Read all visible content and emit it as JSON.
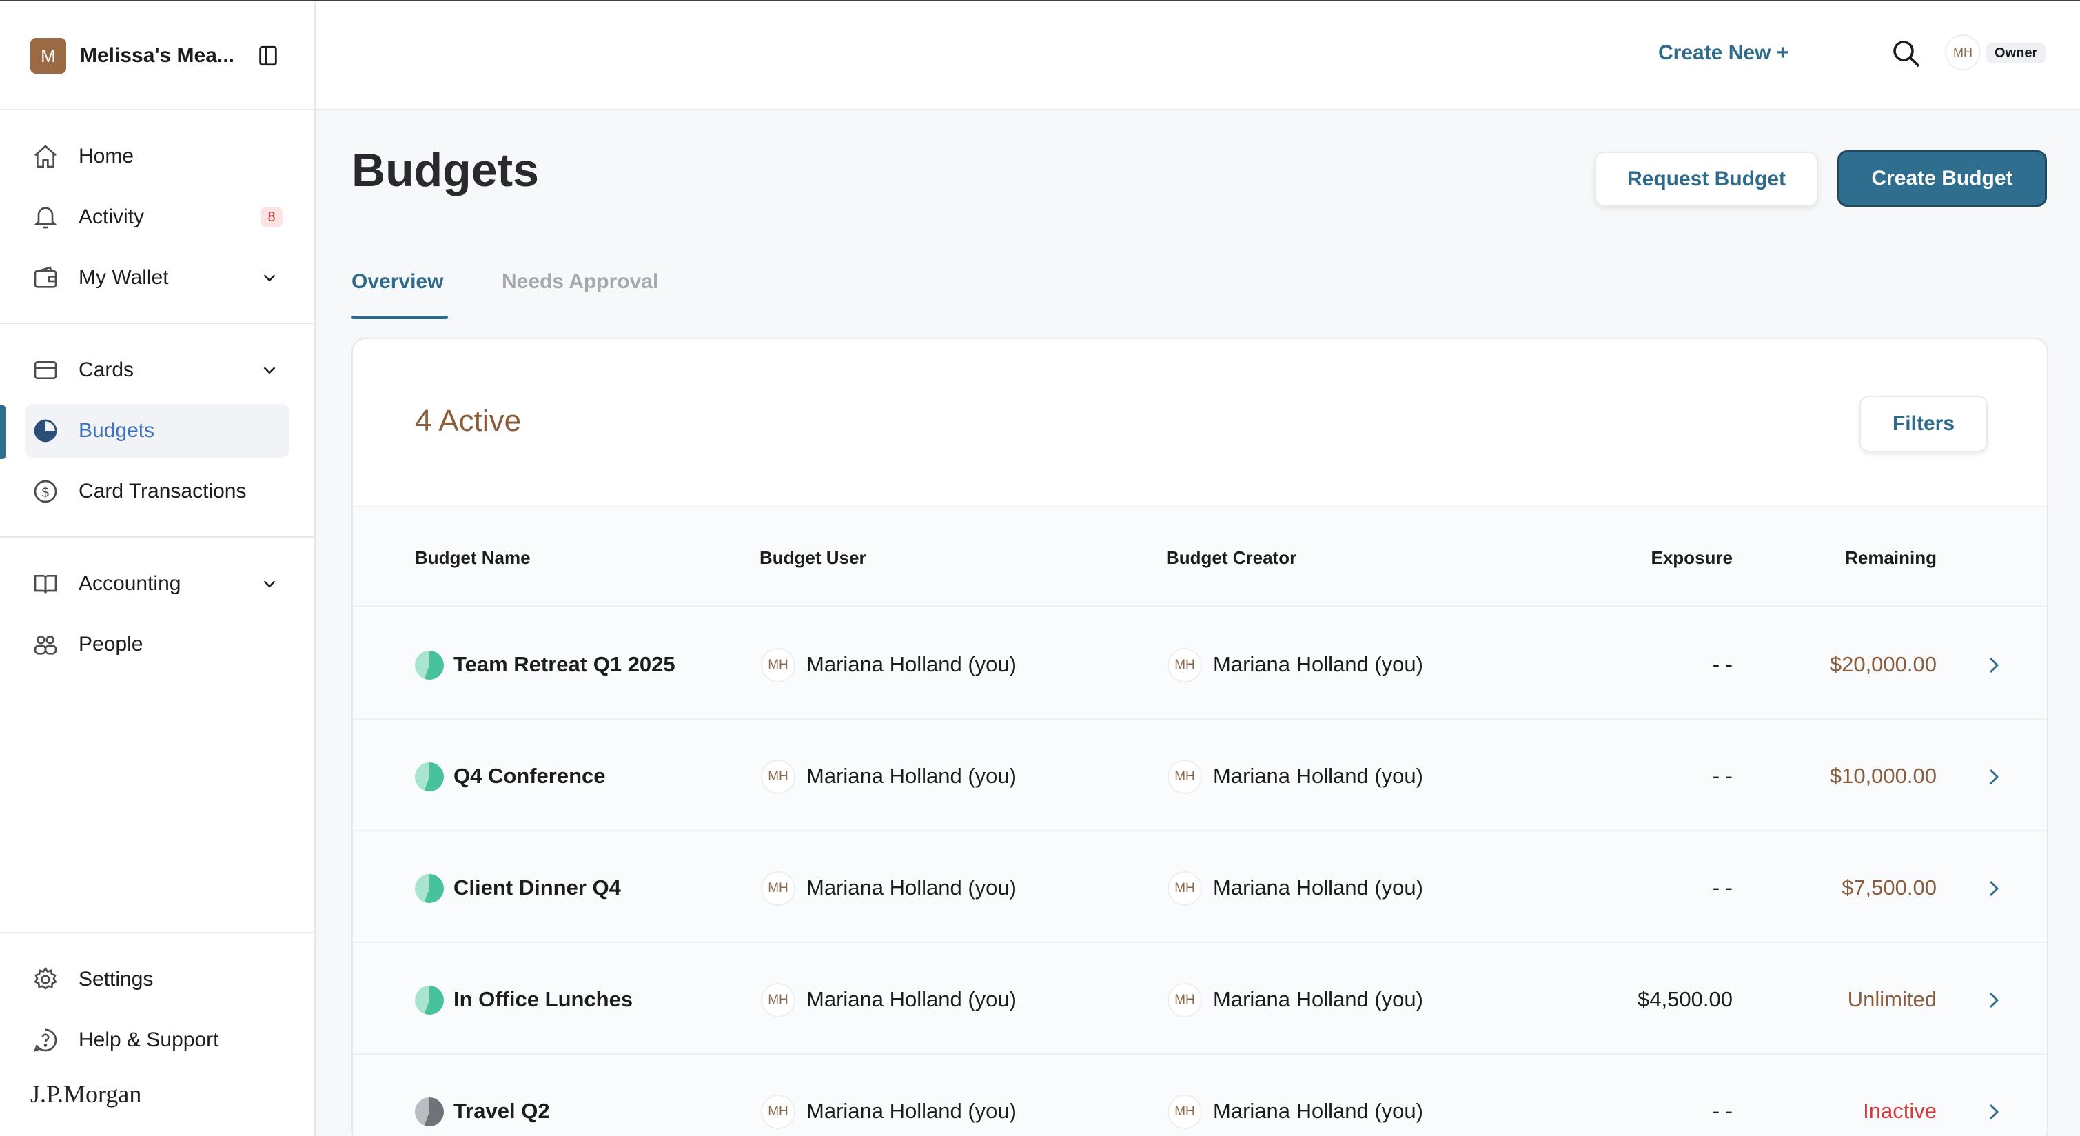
{
  "org": {
    "initial": "M",
    "name": "Melissa's Mea..."
  },
  "nav": {
    "main": [
      {
        "label": "Home",
        "icon": "home-icon"
      },
      {
        "label": "Activity",
        "icon": "bell-icon",
        "badge": "8"
      },
      {
        "label": "My Wallet",
        "icon": "wallet-icon"
      }
    ],
    "spend": [
      {
        "label": "Cards",
        "icon": "card-icon"
      },
      {
        "label": "Budgets",
        "icon": "pie-icon",
        "active": true
      },
      {
        "label": "Card Transactions",
        "icon": "dollar-icon"
      }
    ],
    "manage": [
      {
        "label": "Accounting",
        "icon": "book-icon"
      },
      {
        "label": "People",
        "icon": "people-icon"
      }
    ],
    "footer": [
      {
        "label": "Settings",
        "icon": "gear-icon"
      },
      {
        "label": "Help & Support",
        "icon": "help-icon"
      }
    ],
    "brand": "J.P.Morgan"
  },
  "header": {
    "create_new": "Create New +",
    "avatar": "MH",
    "role": "Owner"
  },
  "page": {
    "title": "Budgets",
    "request_button": "Request Budget",
    "create_button": "Create Budget",
    "tabs": [
      "Overview",
      "Needs Approval"
    ]
  },
  "table": {
    "count_label": "4 Active",
    "filters_label": "Filters",
    "columns": [
      "Budget Name",
      "Budget User",
      "Budget Creator",
      "Exposure",
      "Remaining"
    ],
    "rows": [
      {
        "name": "Team Retreat Q1 2025",
        "status": "active",
        "user_initials": "MH",
        "user": "Mariana Holland (you)",
        "creator_initials": "MH",
        "creator": "Mariana Holland (you)",
        "exposure": "- -",
        "remaining": "$20,000.00",
        "remaining_color": "#8a5e3c"
      },
      {
        "name": "Q4 Conference",
        "status": "active",
        "user_initials": "MH",
        "user": "Mariana Holland (you)",
        "creator_initials": "MH",
        "creator": "Mariana Holland (you)",
        "exposure": "- -",
        "remaining": "$10,000.00",
        "remaining_color": "#8a5e3c"
      },
      {
        "name": "Client Dinner Q4",
        "status": "active",
        "user_initials": "MH",
        "user": "Mariana Holland (you)",
        "creator_initials": "MH",
        "creator": "Mariana Holland (you)",
        "exposure": "- -",
        "remaining": "$7,500.00",
        "remaining_color": "#8a5e3c"
      },
      {
        "name": "In Office Lunches",
        "status": "active",
        "user_initials": "MH",
        "user": "Mariana Holland (you)",
        "creator_initials": "MH",
        "creator": "Mariana Holland (you)",
        "exposure": "$4,500.00",
        "remaining": "Unlimited",
        "remaining_color": "#8a5e3c"
      },
      {
        "name": "Travel Q2",
        "status": "inactive",
        "user_initials": "MH",
        "user": "Mariana Holland (you)",
        "creator_initials": "MH",
        "creator": "Mariana Holland (you)",
        "exposure": "- -",
        "remaining": "Inactive",
        "remaining_color": "#d23b3b"
      }
    ]
  },
  "colors": {
    "accent": "#2e6a8a",
    "active_nav": "#3f73b8",
    "brown": "#8a5e3c",
    "danger": "#d23b3b"
  }
}
